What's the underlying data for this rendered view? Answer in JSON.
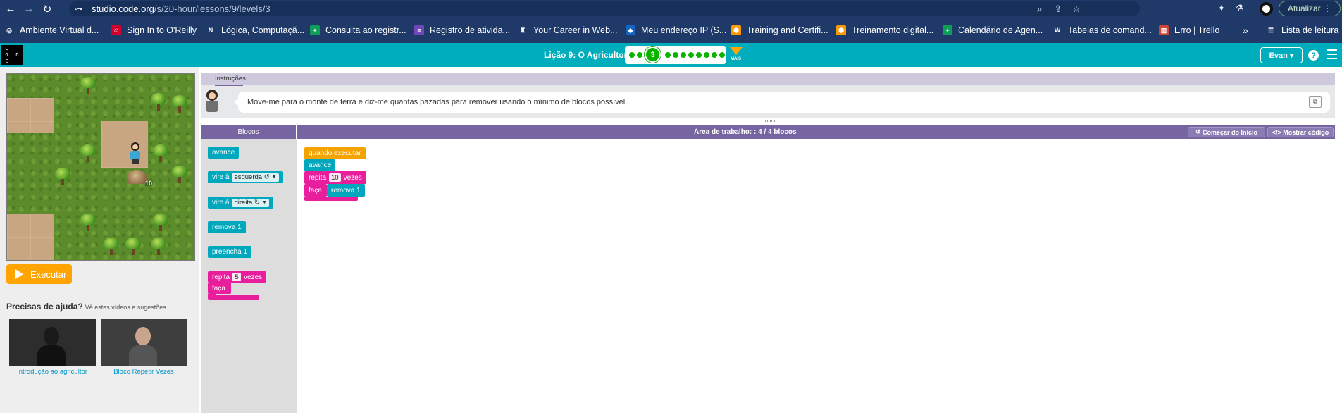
{
  "browser": {
    "url_domain": "studio.code.org",
    "url_path": "/s/20-hour/lessons/9/levels/3",
    "update_label": "Atualizar",
    "bookmarks": [
      {
        "label": "Ambiente Virtual d...",
        "icon": "globe-icon",
        "color": "#bdbdbd"
      },
      {
        "label": "Sign In to O'Reilly",
        "icon": "oreilly-icon",
        "color": "#d3002d"
      },
      {
        "label": "Lógica, Computaçã...",
        "icon": "notion-icon",
        "color": "#ffffff"
      },
      {
        "label": "Consulta ao registr...",
        "icon": "sheets-icon",
        "color": "#0f9d58"
      },
      {
        "label": "Registro de ativida...",
        "icon": "forms-icon",
        "color": "#7248b9"
      },
      {
        "label": "Your Career in Web...",
        "icon": "career-icon",
        "color": "#ffffff"
      },
      {
        "label": "Meu endereço IP (S...",
        "icon": "ip-icon",
        "color": "#1565c0"
      },
      {
        "label": "Training and Certifi...",
        "icon": "aws-icon",
        "color": "#ff9900"
      },
      {
        "label": "Treinamento digital...",
        "icon": "aws-icon",
        "color": "#ff9900"
      },
      {
        "label": "Calendário de Agen...",
        "icon": "sheets-icon",
        "color": "#0f9d58"
      },
      {
        "label": "Tabelas de comand...",
        "icon": "wordpress-icon",
        "color": "#ffffff"
      },
      {
        "label": "Erro | Trello",
        "icon": "trello-icon",
        "color": "#d04437"
      }
    ],
    "reading_list_label": "Lista de leitura"
  },
  "header": {
    "logo_letters": [
      "C",
      "O",
      "D",
      "E"
    ],
    "lesson_title": "Lição 9: O Agricultor",
    "current_level": "3",
    "more_label": "MAIS",
    "user_label": "Evan",
    "help_label": "?"
  },
  "game": {
    "run_label": "Executar",
    "mound_count": "10"
  },
  "help": {
    "title": "Precisas de ajuda?",
    "subtitle": "Vê estes vídeos e sugestões",
    "videos": [
      {
        "caption": "Introdução ao agricultor"
      },
      {
        "caption": "Bloco Repetir Vezes"
      }
    ]
  },
  "instructions": {
    "tab_label": "Instruções",
    "text": "Move-me para o monte de terra e diz-me quantas pazadas para remover usando o mínimo de blocos possível."
  },
  "workspace": {
    "toolbox_label": "Blocos",
    "title": "Área de trabalho: : 4 / 4 blocos",
    "start_over_label": "Começar do Início",
    "show_code_label": "Mostrar código",
    "toolbox_blocks": {
      "move": "avance",
      "turn_left": "vire à",
      "turn_left_dir": "esquerda ↺",
      "turn_right": "vire à",
      "turn_right_dir": "direita ↻",
      "remove": "remova 1",
      "fill": "preencha 1",
      "repeat": "repita",
      "repeat_count": "5",
      "repeat_times": "vezes",
      "do": "faça"
    },
    "program": {
      "when_run": "quando executar",
      "move": "avance",
      "repeat": "repita",
      "repeat_count": "10",
      "repeat_times": "vezes",
      "do": "faça",
      "inner": "remova 1"
    }
  }
}
